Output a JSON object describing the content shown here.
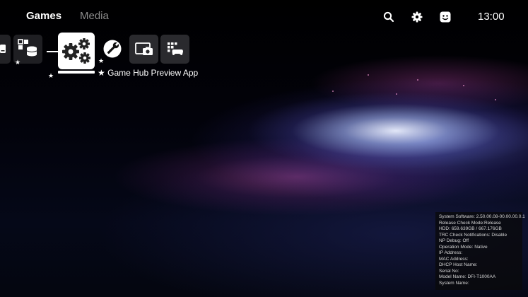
{
  "header": {
    "tabs": [
      {
        "label": "Games",
        "active": true
      },
      {
        "label": "Media",
        "active": false
      }
    ],
    "icons": [
      "search-icon",
      "gear-icon",
      "profile-avatar-icon"
    ],
    "clock": "13:00"
  },
  "tiles": [
    {
      "icon": "storage-device-icon",
      "favorite": false
    },
    {
      "icon": "apps-database-icon",
      "favorite": true
    },
    {
      "icon": "gears-icon",
      "favorite": true,
      "selected": true
    },
    {
      "icon": "wrench-icon",
      "favorite": true
    },
    {
      "icon": "screen-capture-icon",
      "favorite": false
    },
    {
      "icon": "game-library-icon",
      "favorite": false
    }
  ],
  "focused_app": {
    "star": "★",
    "title": "Game Hub Preview App"
  },
  "system_info": [
    "System Software: 2.50.00.08-00.00.00.0.1",
    "Release Check Mode:Release",
    "HDD: 659.639GB / 667.176GB",
    "TRC Check Notifications: Disable",
    "NP Debug: Off",
    "Operation Mode: Native",
    "IP Address:",
    "MAC Address:",
    "DHCP Host Name:",
    "Serial No:",
    "Model Name: DFI-T1000AA",
    "System Name:"
  ],
  "colors": {
    "active_tab": "#ffffff",
    "inactive_tab": "#8c8c8c",
    "tile_bg": "#2a2a2e",
    "info_text": "#d8d8d8"
  }
}
